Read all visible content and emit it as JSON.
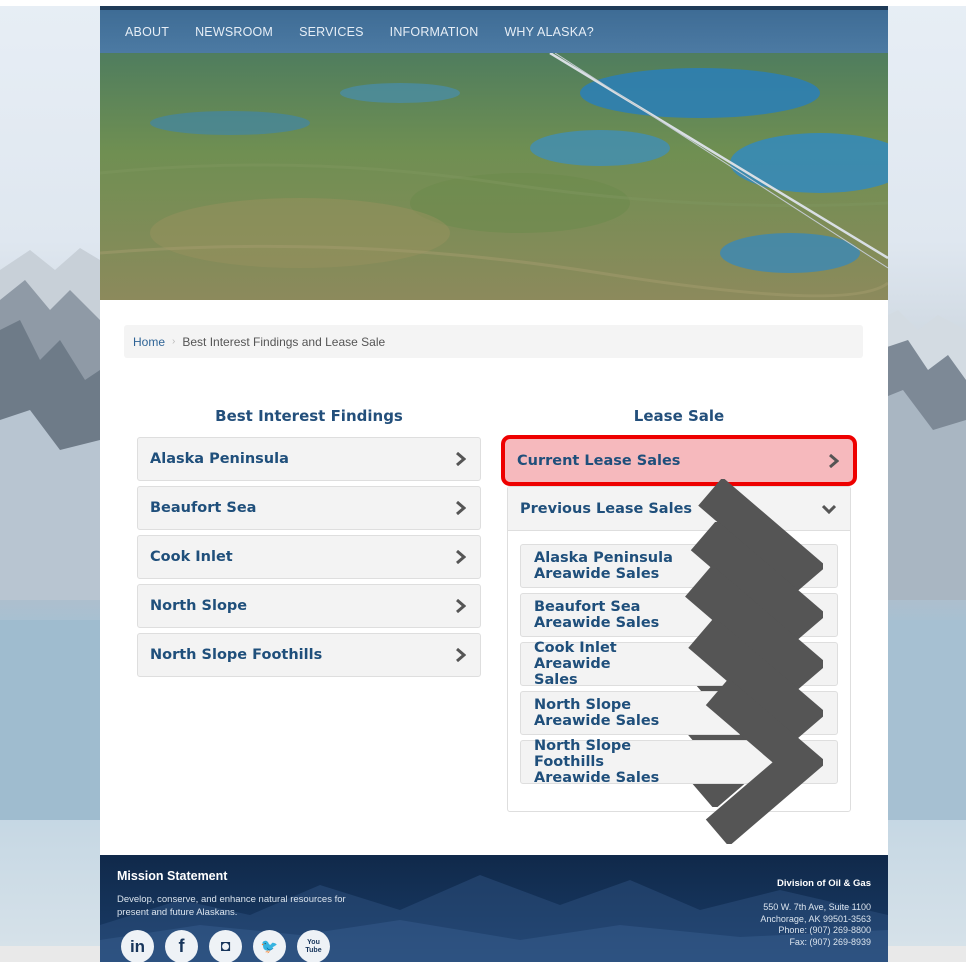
{
  "nav": {
    "items": [
      {
        "label": "About"
      },
      {
        "label": "Newsroom"
      },
      {
        "label": "Services"
      },
      {
        "label": "Information"
      },
      {
        "label": "Why Alaska?"
      }
    ]
  },
  "breadcrumb": {
    "home": "Home",
    "separator": "›",
    "current": "Best Interest Findings and Lease Sale"
  },
  "best_interest": {
    "title": "Best Interest Findings",
    "items": [
      {
        "label": "Alaska Peninsula"
      },
      {
        "label": "Beaufort Sea"
      },
      {
        "label": "Cook Inlet"
      },
      {
        "label": "North Slope"
      },
      {
        "label": "North Slope Foothills"
      }
    ]
  },
  "lease_sale": {
    "title": "Lease Sale",
    "current": {
      "label": "Current Lease Sales"
    },
    "previous": {
      "label": "Previous Lease Sales"
    },
    "previous_items": [
      {
        "label": "Alaska Peninsula Areawide Sales"
      },
      {
        "label": "Beaufort Sea Areawide Sales"
      },
      {
        "label": "Cook Inlet Areawide Sales"
      },
      {
        "label": "North Slope Areawide Sales"
      },
      {
        "label": "North Slope Foothills Areawide Sales"
      }
    ]
  },
  "footer": {
    "mission_title": "Mission Statement",
    "mission_text": "Develop, conserve, and enhance natural resources for present and future Alaskans.",
    "division": "Division of Oil & Gas",
    "address": [
      "550 W. 7th Ave, Suite 1100",
      "Anchorage, AK 99501-3563",
      "Phone: (907) 269-8800",
      "Fax: (907) 269-8939"
    ],
    "social": [
      {
        "icon": "linkedin-icon",
        "glyph": "in"
      },
      {
        "icon": "facebook-icon",
        "glyph": "f"
      },
      {
        "icon": "instagram-icon",
        "glyph": "◘"
      },
      {
        "icon": "twitter-icon",
        "glyph": "🐦"
      },
      {
        "icon": "youtube-icon",
        "glyph": "You Tube"
      }
    ]
  },
  "colors": {
    "nav_bg": "#4c7aa3",
    "link": "#1f4f7b",
    "highlight_border": "#ee0000",
    "highlight_fill": "#f6b9bd",
    "footer_bg": "#16355d"
  }
}
